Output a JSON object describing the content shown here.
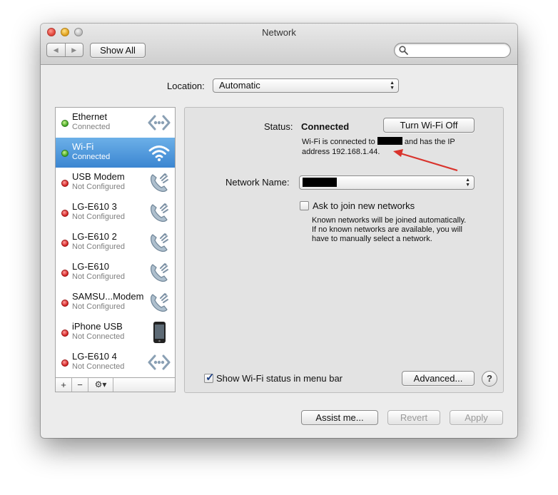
{
  "window": {
    "title": "Network"
  },
  "toolbar": {
    "back": "◀",
    "forward": "▶",
    "show_all": "Show All",
    "search_placeholder": ""
  },
  "location": {
    "label": "Location:",
    "value": "Automatic"
  },
  "services": [
    {
      "name": "Ethernet",
      "status": "Connected",
      "dot": "green",
      "icon": "ethernet-icon"
    },
    {
      "name": "Wi-Fi",
      "status": "Connected",
      "dot": "green",
      "icon": "wifi-icon",
      "selected": true
    },
    {
      "name": "USB Modem",
      "status": "Not Configured",
      "dot": "red",
      "icon": "phone-icon"
    },
    {
      "name": "LG-E610 3",
      "status": "Not Configured",
      "dot": "red",
      "icon": "phone-icon"
    },
    {
      "name": "LG-E610 2",
      "status": "Not Configured",
      "dot": "red",
      "icon": "phone-icon"
    },
    {
      "name": "LG-E610",
      "status": "Not Configured",
      "dot": "red",
      "icon": "phone-icon"
    },
    {
      "name": "SAMSU...Modem",
      "status": "Not Configured",
      "dot": "red",
      "icon": "phone-icon"
    },
    {
      "name": "iPhone USB",
      "status": "Not Connected",
      "dot": "red",
      "icon": "iphone-icon"
    },
    {
      "name": "LG-E610 4",
      "status": "Not Connected",
      "dot": "red",
      "icon": "ethernet-icon"
    }
  ],
  "sidebar_controls": {
    "add": "+",
    "remove": "−",
    "gear": "⚙▾"
  },
  "detail": {
    "status_label": "Status:",
    "status_value": "Connected",
    "turn_off": "Turn Wi-Fi Off",
    "desc_part1": "Wi-Fi is connected to",
    "desc_part2": "and has the IP",
    "desc_line2": "address 192.168.1.44.",
    "network_name_label": "Network Name:",
    "ask_label": "Ask to join new networks",
    "ask_desc_1": "Known networks will be joined automatically.",
    "ask_desc_2": "If no known networks are available, you will",
    "ask_desc_3": "have to manually select a network.",
    "show_status_label": "Show Wi-Fi status in menu bar",
    "advanced": "Advanced...",
    "help": "?"
  },
  "footer": {
    "assist": "Assist me...",
    "revert": "Revert",
    "apply": "Apply"
  },
  "colors": {
    "selection": "#3b86d1",
    "arrow": "#d9332c",
    "connected": "#3ea21f",
    "not_configured": "#d01e1e"
  }
}
